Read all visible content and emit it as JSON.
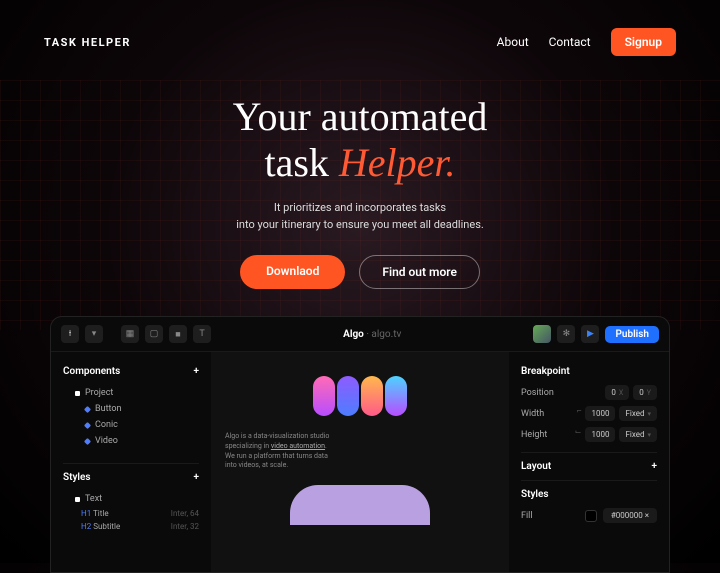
{
  "brand": "TASK HELPER",
  "nav": {
    "about": "About",
    "contact": "Contact",
    "signup": "Signup"
  },
  "hero": {
    "line1": "Your automated",
    "line2a": "task",
    "line2b": "Helper.",
    "sub1": "It prioritizes and incorporates tasks",
    "sub2": "into your itinerary to ensure you meet all deadlines.",
    "cta1": "Downlaod",
    "cta2": "Find out more"
  },
  "app": {
    "title_main": "Algo",
    "title_sub": "algo.tv",
    "publish": "Publish",
    "left": {
      "components": "Components",
      "project": "Project",
      "button": "Button",
      "conic": "Conic",
      "video": "Video",
      "styles": "Styles",
      "text": "Text",
      "title": "Title",
      "title_meta": "Inter, 64",
      "subtitle": "Subtitle",
      "subtitle_meta": "Inter, 32"
    },
    "center": {
      "desc1": "Algo is a data-visualization studio",
      "desc2_a": "specializing in ",
      "desc2_b": "video automation",
      "desc3": "We run a platform that turns data",
      "desc4": "into videos, at scale."
    },
    "right": {
      "breakpoint": "Breakpoint",
      "position": "Position",
      "pos_x": "0",
      "pos_y": "0",
      "width": "Width",
      "width_v": "1000",
      "height": "Height",
      "height_v": "1000",
      "fixed": "Fixed",
      "layout": "Layout",
      "styles": "Styles",
      "fill": "Fill",
      "fill_v": "#000000"
    }
  }
}
